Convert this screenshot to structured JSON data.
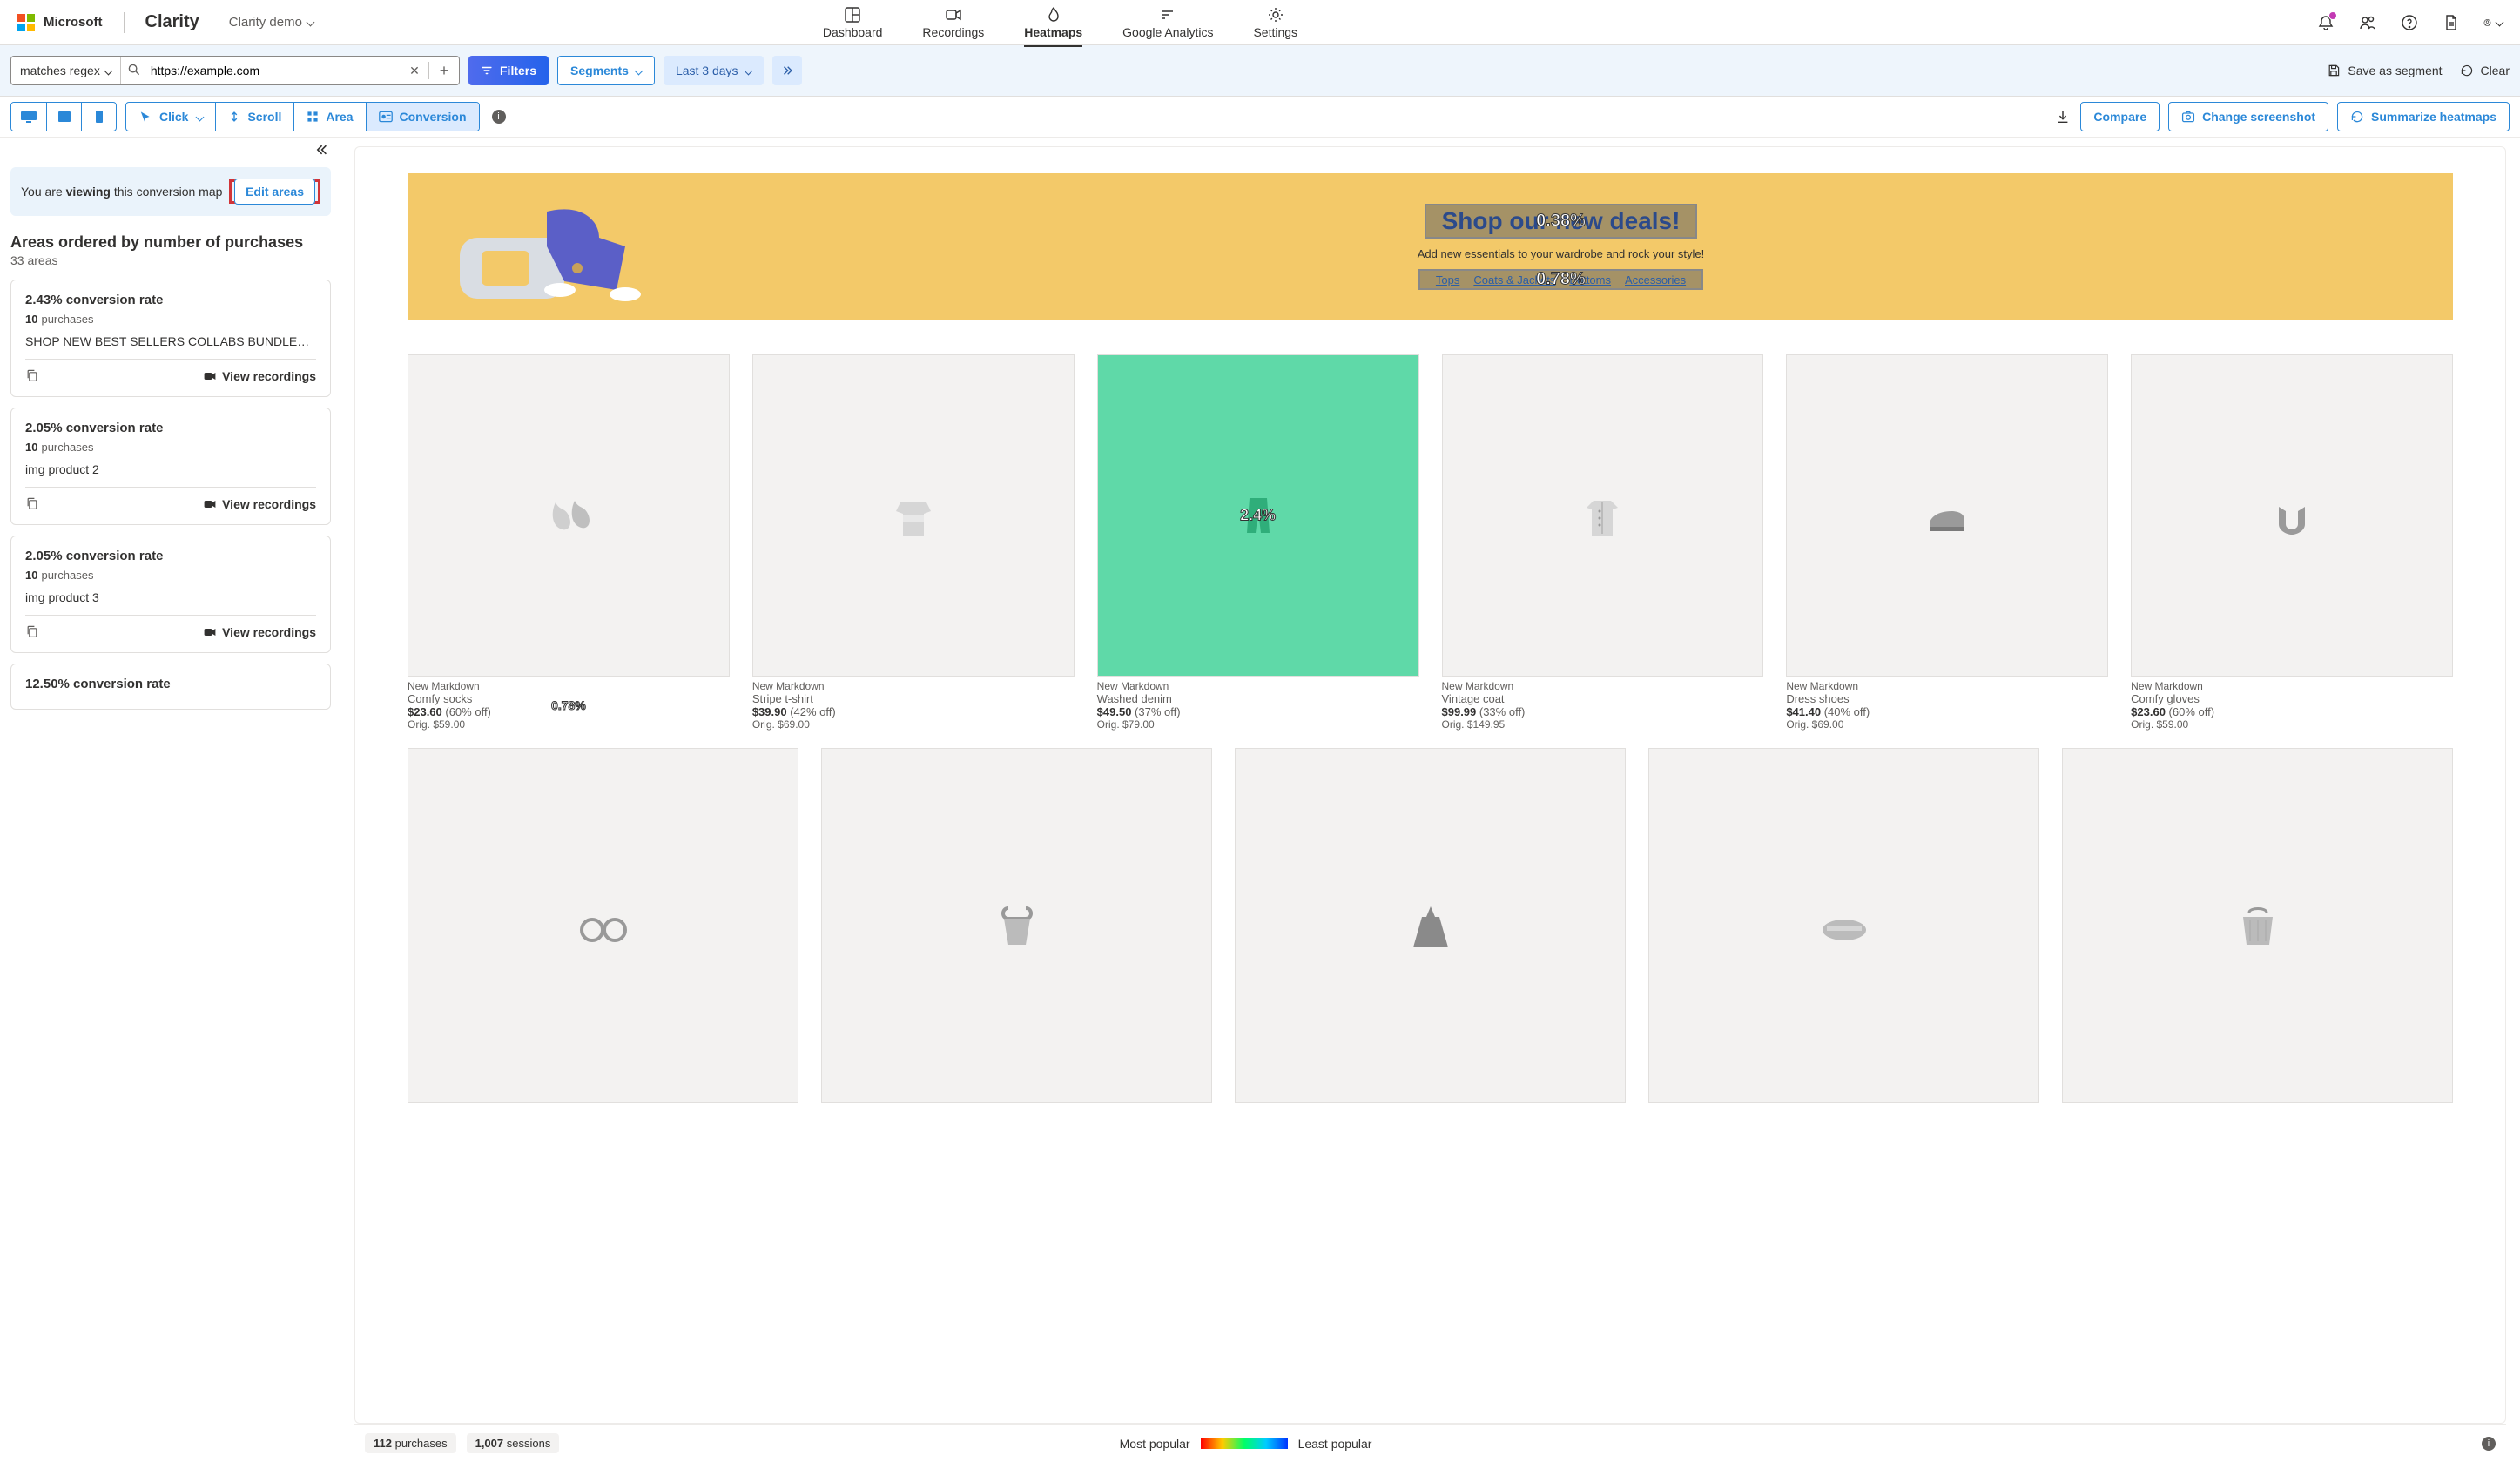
{
  "brand": {
    "microsoft": "Microsoft",
    "product": "Clarity"
  },
  "project": {
    "name": "Clarity demo"
  },
  "nav": {
    "dashboard": "Dashboard",
    "recordings": "Recordings",
    "heatmaps": "Heatmaps",
    "ga": "Google Analytics",
    "settings": "Settings"
  },
  "filter": {
    "mode": "matches regex",
    "url": "https://example.com",
    "filters": "Filters",
    "segments": "Segments",
    "range": "Last 3 days",
    "save": "Save as segment",
    "clear": "Clear"
  },
  "toolbar": {
    "click": "Click",
    "scroll": "Scroll",
    "area": "Area",
    "conversion": "Conversion",
    "compare": "Compare",
    "change": "Change screenshot",
    "summarize": "Summarize heatmaps"
  },
  "side": {
    "viewing_pre": "You are ",
    "viewing_b": "viewing",
    "viewing_post": " this conversion map",
    "edit": "Edit areas",
    "title": "Areas ordered by number of purchases",
    "count": "33 areas",
    "view_rec": "View recordings",
    "areas": [
      {
        "rate": "2.43% conversion rate",
        "n": "10",
        "plabel": "purchases",
        "label": "SHOP NEW BEST SELLERS COLLABS BUNDLES AC..."
      },
      {
        "rate": "2.05% conversion rate",
        "n": "10",
        "plabel": "purchases",
        "label": "img product 2"
      },
      {
        "rate": "2.05% conversion rate",
        "n": "10",
        "plabel": "purchases",
        "label": "img product 3"
      },
      {
        "rate": "12.50% conversion rate",
        "n": "",
        "plabel": "",
        "label": ""
      }
    ]
  },
  "hero": {
    "title": "Shop our new deals!",
    "pct1": "0.38%",
    "sub": "Add new essentials to your wardrobe and rock your style!",
    "links": [
      "Tops",
      "Coats & Jackets",
      "Bottoms",
      "Accessories"
    ],
    "pct2": "0.78%"
  },
  "products": [
    {
      "tag": "New Markdown",
      "name": "Comfy socks",
      "price": "$23.60",
      "off": "(60% off)",
      "orig": "Orig. $59.00",
      "hot": false,
      "descOverlay": true,
      "descPct": "0.78%"
    },
    {
      "tag": "New Markdown",
      "name": "Stripe t-shirt",
      "price": "$39.90",
      "off": "(42% off)",
      "orig": "Orig. $69.00",
      "hot": false
    },
    {
      "tag": "New Markdown",
      "name": "Washed denim",
      "price": "$49.50",
      "off": "(37% off)",
      "orig": "Orig. $79.00",
      "hot": true,
      "hotPct": "2.4%"
    },
    {
      "tag": "New Markdown",
      "name": "Vintage coat",
      "price": "$99.99",
      "off": "(33% off)",
      "orig": "Orig. $149.95",
      "hot": false
    },
    {
      "tag": "New Markdown",
      "name": "Dress shoes",
      "price": "$41.40",
      "off": "(40% off)",
      "orig": "Orig. $69.00",
      "hot": false
    },
    {
      "tag": "New Markdown",
      "name": "Comfy gloves",
      "price": "$23.60",
      "off": "(60% off)",
      "orig": "Orig. $59.00",
      "hot": false
    }
  ],
  "footer": {
    "p_n": "112",
    "p_l": "purchases",
    "s_n": "1,007",
    "s_l": "sessions",
    "most": "Most popular",
    "least": "Least popular"
  }
}
